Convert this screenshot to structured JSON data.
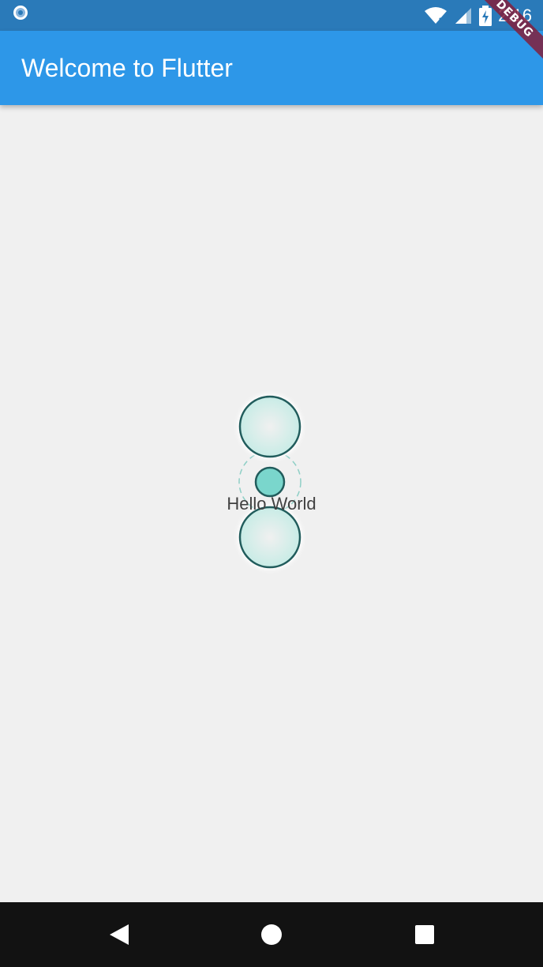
{
  "status_bar": {
    "time": "2:16",
    "icons": [
      "app-indicator-icon",
      "wifi-icon",
      "signal-icon",
      "battery-charging-icon"
    ]
  },
  "app_bar": {
    "title": "Welcome to Flutter"
  },
  "debug_banner": {
    "label": "DEBUG"
  },
  "content": {
    "text": "Hello World"
  },
  "nav_bar": {
    "icons": [
      "back-icon",
      "home-icon",
      "recent-apps-icon"
    ]
  },
  "colors": {
    "status_bar": "#2a7ab9",
    "app_bar": "#2d97e8",
    "background": "#f0f0f0",
    "circle_fill": "#d4f0ec",
    "circle_stroke": "#215c5c",
    "center_fill": "#7ad6cc",
    "dashed_ring": "#8fcfc6",
    "nav_bar": "#121212"
  }
}
